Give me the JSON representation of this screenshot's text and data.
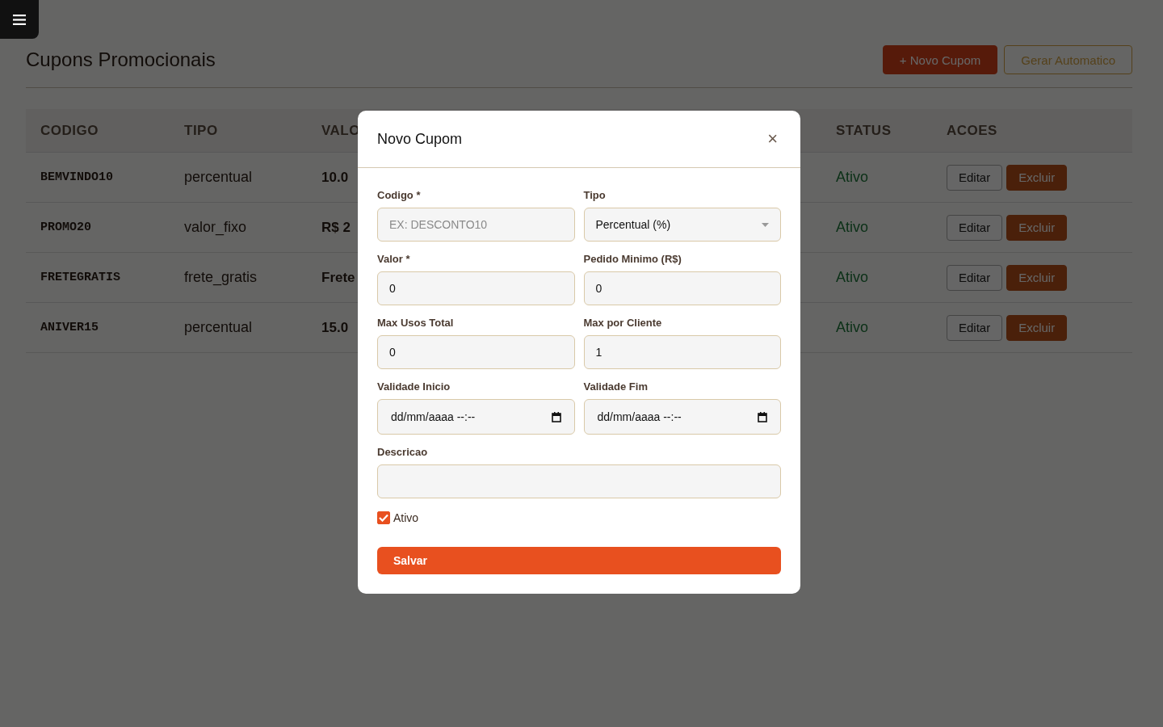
{
  "page": {
    "title": "Cupons Promocionais",
    "actions": [
      {
        "label": "+ Novo Cupom",
        "kind": "primary"
      },
      {
        "label": "Gerar Automatico",
        "kind": "outline"
      }
    ]
  },
  "table": {
    "columns": [
      "CODIGO",
      "TIPO",
      "VALO",
      "STATUS",
      "ACOES"
    ],
    "rows": [
      {
        "code": "BEMVINDO10",
        "type": "percentual",
        "value": "10.0",
        "status": "Ativo",
        "actions": [
          "Editar",
          "Excluir"
        ]
      },
      {
        "code": "PROMO20",
        "type": "valor_fixo",
        "value": "R$ 2",
        "status": "Ativo",
        "actions": [
          "Editar",
          "Excluir"
        ]
      },
      {
        "code": "FRETEGRATIS",
        "type": "frete_gratis",
        "value": "Frete",
        "status": "Ativo",
        "actions": [
          "Editar",
          "Excluir"
        ]
      },
      {
        "code": "ANIVER15",
        "type": "percentual",
        "value": "15.0",
        "status": "Ativo",
        "actions": [
          "Editar",
          "Excluir"
        ]
      }
    ]
  },
  "modal": {
    "title": "Novo Cupom",
    "close": "×",
    "fields": [
      {
        "label": "Codigo *",
        "kind": "text",
        "placeholder": "EX: DESCONTO10"
      },
      {
        "label": "Tipo",
        "kind": "select",
        "value": "Percentual (%)"
      },
      {
        "label": "Valor *",
        "kind": "text",
        "value": "0"
      },
      {
        "label": "Pedido Minimo (R$)",
        "kind": "text",
        "value": "0"
      },
      {
        "label": "Max Usos Total",
        "kind": "text",
        "value": "0"
      },
      {
        "label": "Max por Cliente",
        "kind": "text",
        "value": "1"
      },
      {
        "label": "Validade Inicio",
        "kind": "date",
        "placeholder": "dd/mm/aaaa --:--"
      },
      {
        "label": "Validade Fim",
        "kind": "date",
        "placeholder": "dd/mm/aaaa --:--"
      },
      {
        "label": "Descricao",
        "kind": "wide"
      }
    ],
    "checkbox": {
      "label": "Ativo",
      "checked": true
    },
    "submit": "Salvar"
  }
}
